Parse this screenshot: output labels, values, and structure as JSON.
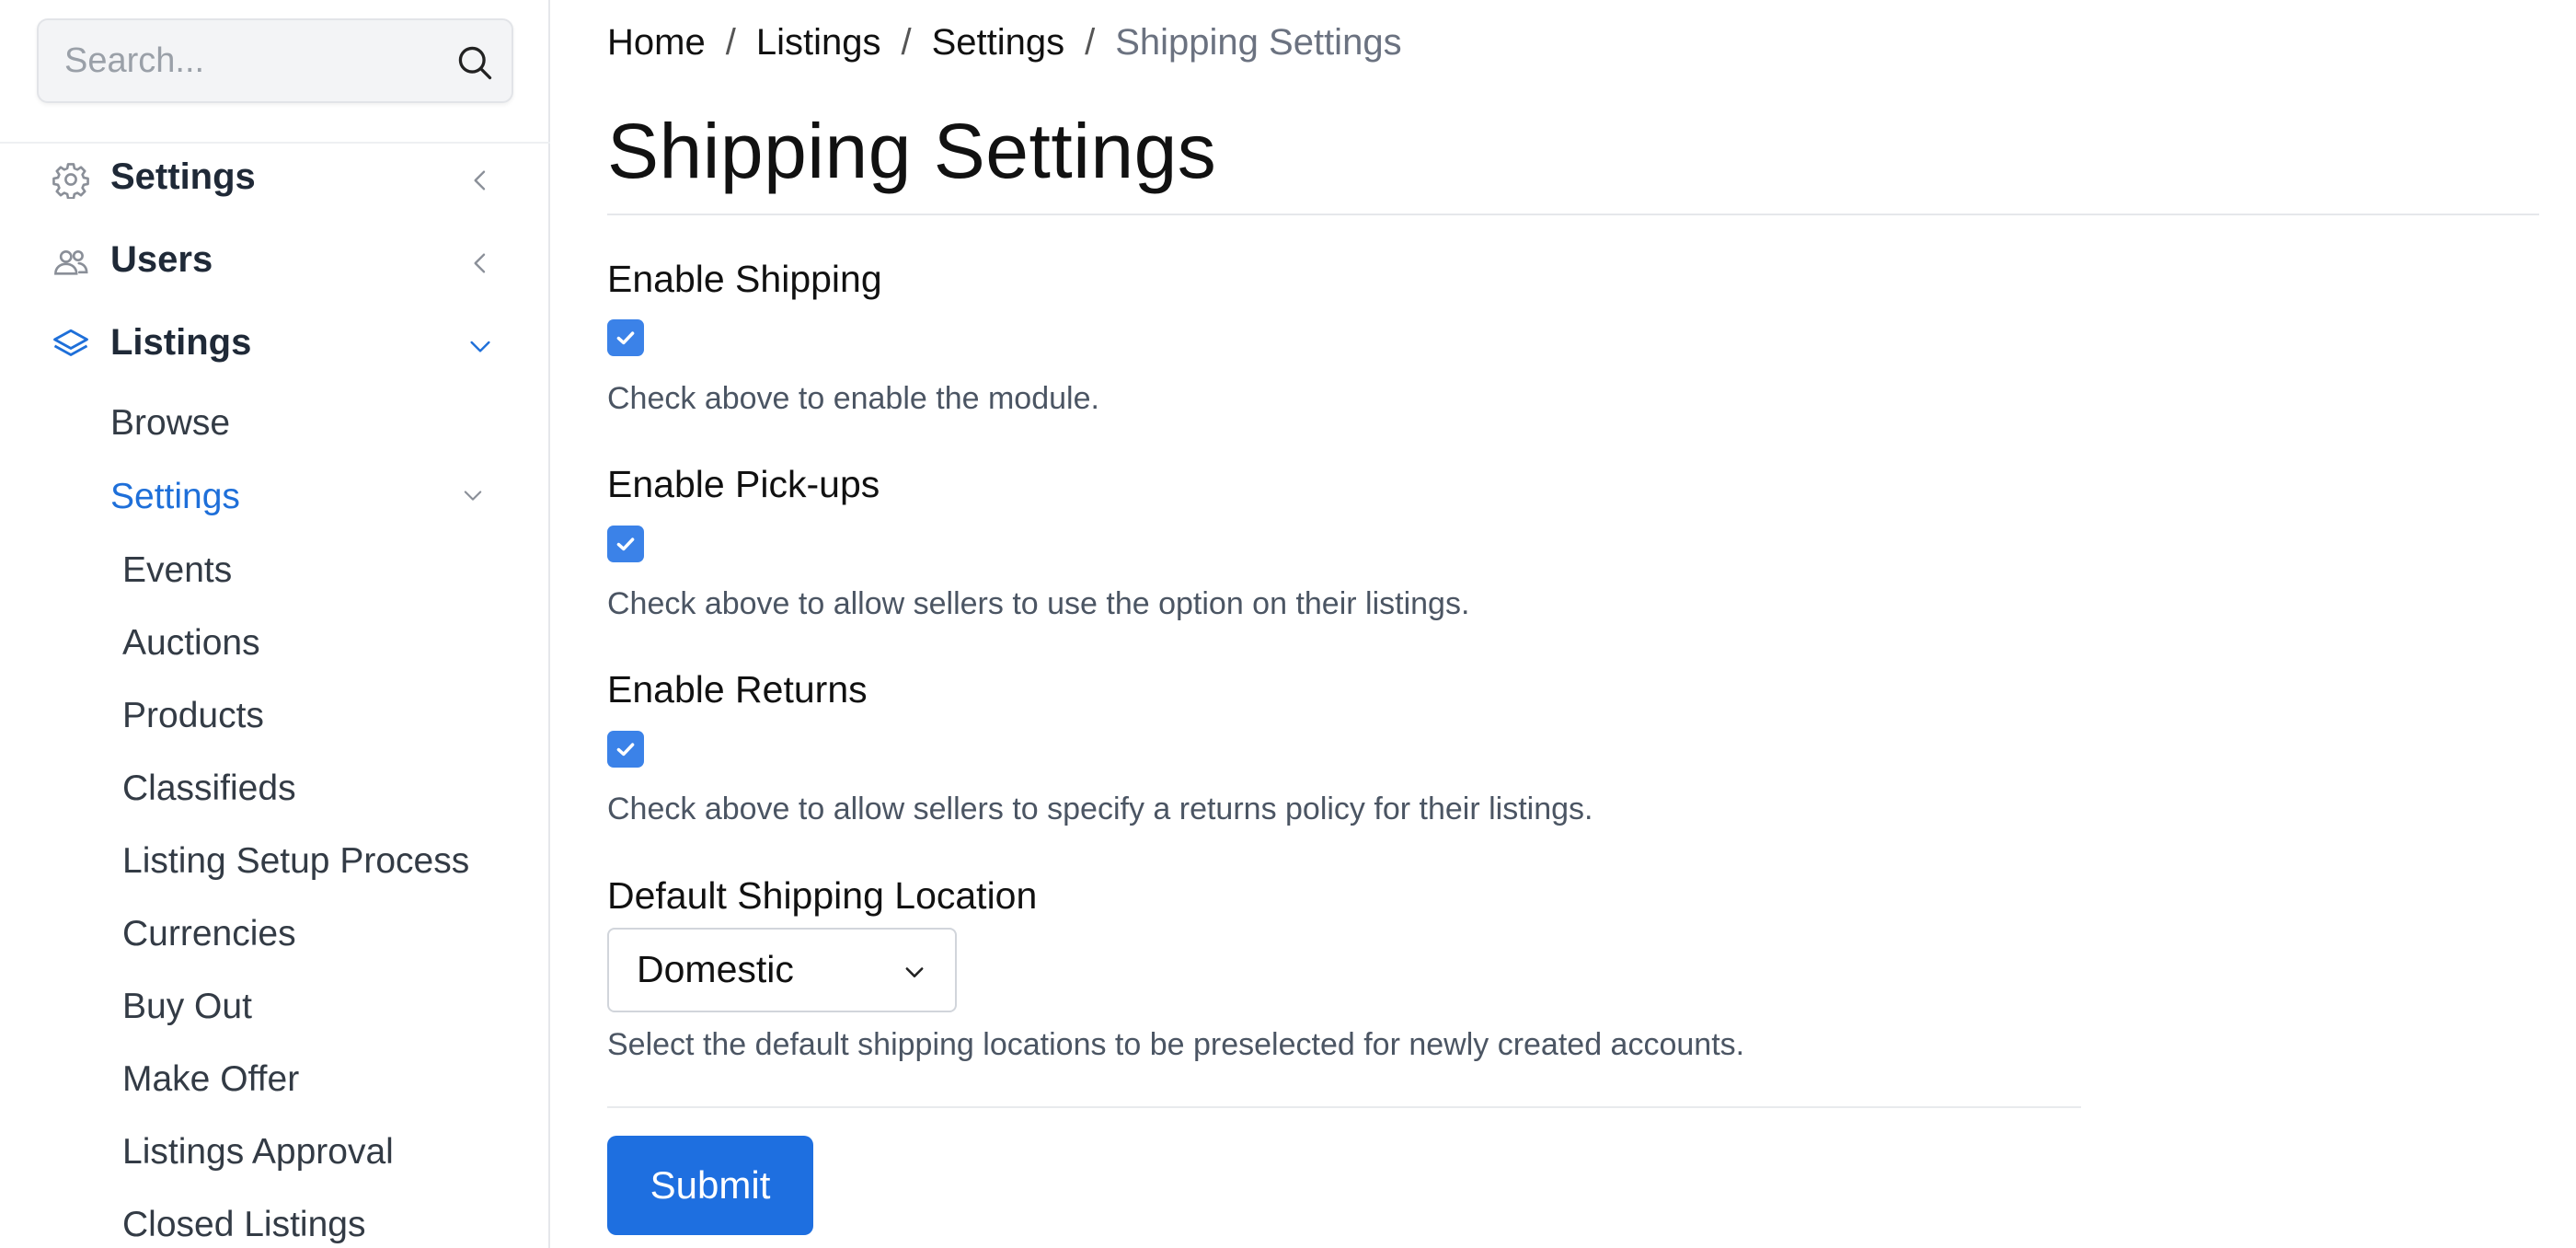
{
  "search": {
    "placeholder": "Search..."
  },
  "sidebar": {
    "items": [
      {
        "label": "Settings",
        "icon": "gear-icon"
      },
      {
        "label": "Users",
        "icon": "users-icon"
      },
      {
        "label": "Listings",
        "icon": "layers-icon"
      }
    ],
    "listings_children": [
      {
        "label": "Browse"
      },
      {
        "label": "Settings"
      }
    ],
    "settings_children": [
      {
        "label": "Events"
      },
      {
        "label": "Auctions"
      },
      {
        "label": "Products"
      },
      {
        "label": "Classifieds"
      },
      {
        "label": "Listing Setup Process"
      },
      {
        "label": "Currencies"
      },
      {
        "label": "Buy Out"
      },
      {
        "label": "Make Offer"
      },
      {
        "label": "Listings Approval"
      },
      {
        "label": "Closed Listings"
      }
    ]
  },
  "breadcrumb": {
    "items": [
      "Home",
      "Listings",
      "Settings"
    ],
    "current": "Shipping Settings",
    "separator": "/"
  },
  "page": {
    "title": "Shipping Settings"
  },
  "form": {
    "fields": [
      {
        "label": "Enable Shipping",
        "checked": true,
        "help": "Check above to enable the module."
      },
      {
        "label": "Enable Pick-ups",
        "checked": true,
        "help": "Check above to allow sellers to use the option on their listings."
      },
      {
        "label": "Enable Returns",
        "checked": true,
        "help": "Check above to allow sellers to specify a returns policy for their listings."
      }
    ],
    "location": {
      "label": "Default Shipping Location",
      "value": "Domestic",
      "help": "Select the default shipping locations to be preselected for newly created accounts."
    },
    "submit_label": "Submit"
  },
  "colors": {
    "accent": "#1e6fe0",
    "checkbox": "#3b82e8",
    "active_link": "#1e6fd9"
  }
}
